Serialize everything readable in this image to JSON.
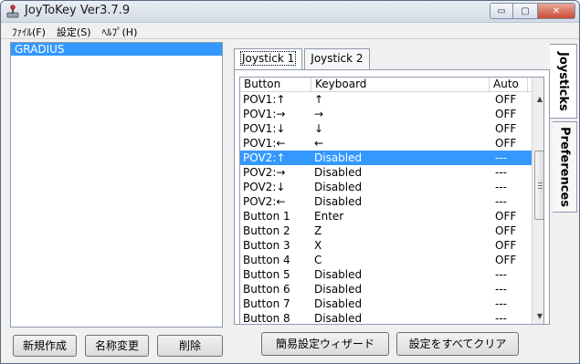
{
  "window": {
    "title": "JoyToKey Ver3.7.9",
    "controls": {
      "minimize": "▭",
      "maximize": "▢",
      "close": "✕"
    }
  },
  "menu": [
    "ﾌｧｲﾙ(F)",
    "設定(S)",
    "ﾍﾙﾌﾟ(H)"
  ],
  "profiles": {
    "items": [
      "GRADIUS"
    ],
    "selected_index": 0,
    "buttons": {
      "new": "新規作成",
      "rename": "名称変更",
      "delete": "削除"
    }
  },
  "tabs": [
    {
      "label": "Joystick 1",
      "active": true
    },
    {
      "label": "Joystick 2",
      "active": false
    }
  ],
  "side_tabs": [
    {
      "label": "Joysticks",
      "active": true
    },
    {
      "label": "Preferences",
      "active": false
    }
  ],
  "table": {
    "columns": [
      "Button",
      "Keyboard",
      "Auto"
    ],
    "rows": [
      {
        "button": "POV1:↑",
        "keyboard": "↑",
        "auto": "OFF"
      },
      {
        "button": "POV1:→",
        "keyboard": "→",
        "auto": "OFF"
      },
      {
        "button": "POV1:↓",
        "keyboard": "↓",
        "auto": "OFF"
      },
      {
        "button": "POV1:←",
        "keyboard": "←",
        "auto": "OFF"
      },
      {
        "button": "POV2:↑",
        "keyboard": "Disabled",
        "auto": "---",
        "selected": true
      },
      {
        "button": "POV2:→",
        "keyboard": "Disabled",
        "auto": "---"
      },
      {
        "button": "POV2:↓",
        "keyboard": "Disabled",
        "auto": "---"
      },
      {
        "button": "POV2:←",
        "keyboard": "Disabled",
        "auto": "---"
      },
      {
        "button": "Button 1",
        "keyboard": "Enter",
        "auto": "OFF"
      },
      {
        "button": "Button 2",
        "keyboard": "Z",
        "auto": "OFF"
      },
      {
        "button": "Button 3",
        "keyboard": "X",
        "auto": "OFF"
      },
      {
        "button": "Button 4",
        "keyboard": "C",
        "auto": "OFF"
      },
      {
        "button": "Button 5",
        "keyboard": "Disabled",
        "auto": "---"
      },
      {
        "button": "Button 6",
        "keyboard": "Disabled",
        "auto": "---"
      },
      {
        "button": "Button 7",
        "keyboard": "Disabled",
        "auto": "---"
      },
      {
        "button": "Button 8",
        "keyboard": "Disabled",
        "auto": "---"
      }
    ]
  },
  "bottom_buttons": {
    "wizard": "簡易設定ウィザード",
    "clear_all": "設定をすべてクリア"
  },
  "colors": {
    "selection": "#3399ff",
    "window_frame": "#5b6b84"
  },
  "icons": {
    "app": "joystick-icon",
    "scroll_up": "arrow-up-icon",
    "scroll_down": "arrow-down-icon"
  }
}
